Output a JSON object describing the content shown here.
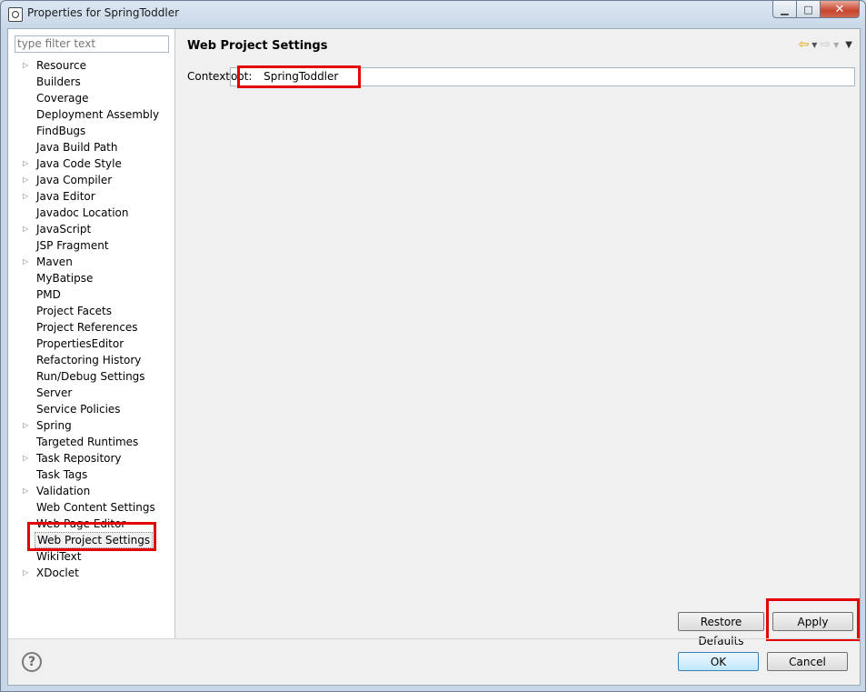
{
  "window": {
    "title": "Properties for SpringToddler",
    "controls": {
      "minimize": "▁",
      "maximize": "□",
      "close": "✕"
    }
  },
  "filter": {
    "placeholder": "type filter text"
  },
  "tree": {
    "items": [
      {
        "label": "Resource",
        "expandable": true
      },
      {
        "label": "Builders",
        "expandable": false
      },
      {
        "label": "Coverage",
        "expandable": false
      },
      {
        "label": "Deployment Assembly",
        "expandable": false
      },
      {
        "label": "FindBugs",
        "expandable": false
      },
      {
        "label": "Java Build Path",
        "expandable": false
      },
      {
        "label": "Java Code Style",
        "expandable": true
      },
      {
        "label": "Java Compiler",
        "expandable": true
      },
      {
        "label": "Java Editor",
        "expandable": true
      },
      {
        "label": "Javadoc Location",
        "expandable": false
      },
      {
        "label": "JavaScript",
        "expandable": true
      },
      {
        "label": "JSP Fragment",
        "expandable": false
      },
      {
        "label": "Maven",
        "expandable": true
      },
      {
        "label": "MyBatipse",
        "expandable": false
      },
      {
        "label": "PMD",
        "expandable": false
      },
      {
        "label": "Project Facets",
        "expandable": false
      },
      {
        "label": "Project References",
        "expandable": false
      },
      {
        "label": "PropertiesEditor",
        "expandable": false
      },
      {
        "label": "Refactoring History",
        "expandable": false
      },
      {
        "label": "Run/Debug Settings",
        "expandable": false
      },
      {
        "label": "Server",
        "expandable": false
      },
      {
        "label": "Service Policies",
        "expandable": false
      },
      {
        "label": "Spring",
        "expandable": true
      },
      {
        "label": "Targeted Runtimes",
        "expandable": false
      },
      {
        "label": "Task Repository",
        "expandable": true
      },
      {
        "label": "Task Tags",
        "expandable": false
      },
      {
        "label": "Validation",
        "expandable": true
      },
      {
        "label": "Web Content Settings",
        "expandable": false
      },
      {
        "label": "Web Page Editor",
        "expandable": false
      },
      {
        "label": "Web Project Settings",
        "expandable": false,
        "selected": true
      },
      {
        "label": "WikiText",
        "expandable": false
      },
      {
        "label": "XDoclet",
        "expandable": true
      }
    ]
  },
  "page": {
    "title": "Web Project Settings",
    "context_label": "Context",
    "context_root_prefix": "oot:",
    "context_root_value": "SpringToddler"
  },
  "buttons": {
    "restore_defaults": "Restore Defaults",
    "apply": "Apply",
    "ok": "OK",
    "cancel": "Cancel"
  },
  "icons": {
    "back": "arrow-left-icon",
    "forward": "arrow-right-icon",
    "help": "help-icon"
  },
  "colors": {
    "highlight_box": "#e30000"
  }
}
